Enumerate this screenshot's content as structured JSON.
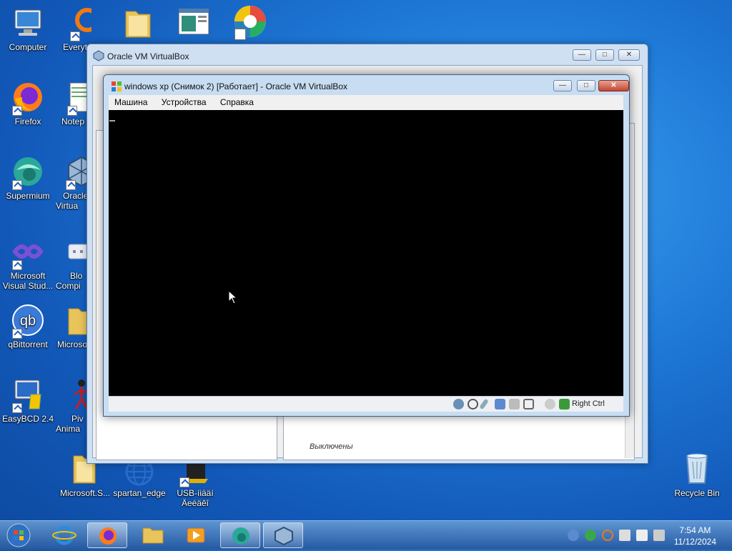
{
  "desktop": {
    "icons": [
      {
        "label": "Computer"
      },
      {
        "label": "Everyt"
      },
      {
        "label": "Firefox"
      },
      {
        "label": "Notep"
      },
      {
        "label": "Supermium"
      },
      {
        "label": "Oracle Virtua"
      },
      {
        "label": "Microsoft Visual Stud..."
      },
      {
        "label": "Blo Compi"
      },
      {
        "label": "qBittorrent"
      },
      {
        "label": "Microso"
      },
      {
        "label": "EasyBCD 2.4"
      },
      {
        "label": "Piv Anima"
      },
      {
        "label": "Microsoft.S..."
      },
      {
        "label": "spartan_edge"
      },
      {
        "label": "USB-íiääí Äeéäêî"
      },
      {
        "label": "Recycle Bin"
      }
    ]
  },
  "manager_window": {
    "title": "Oracle VM VirtualBox",
    "vm_state": "Выключены"
  },
  "vm_window": {
    "title": "windows xp (Снимок 2) [Работает] - Oracle VM VirtualBox",
    "menu": [
      "Машина",
      "Устройства",
      "Справка"
    ],
    "host_key": "Right Ctrl"
  },
  "taskbar": {
    "time": "7:54 AM",
    "date": "11/12/2024"
  },
  "colors": {
    "desktop": "#1f7ad8",
    "vm_screen": "#000000",
    "close_button": "#c4452f"
  }
}
